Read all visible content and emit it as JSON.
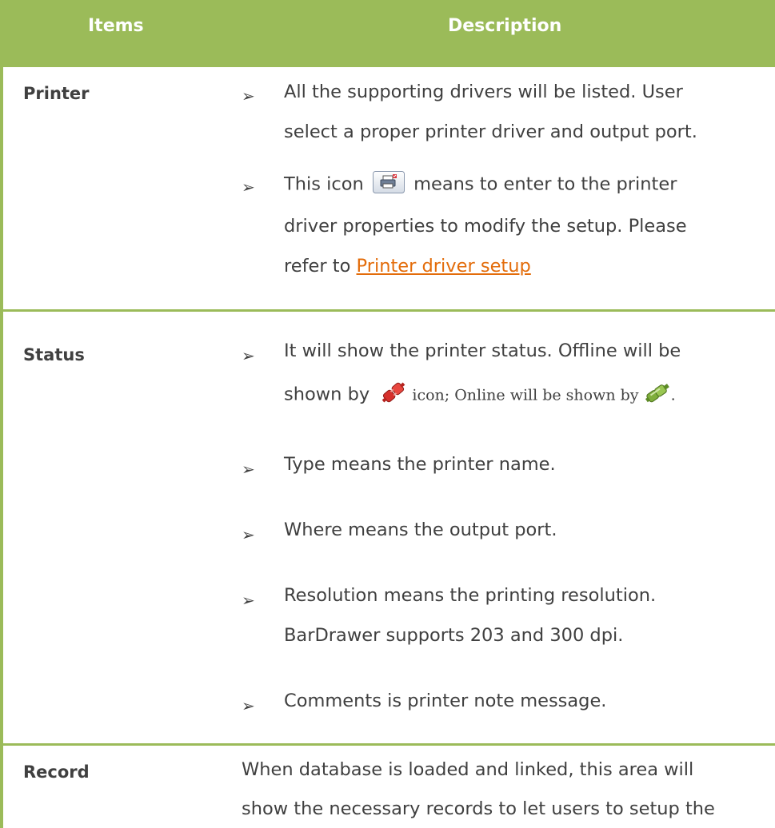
{
  "header": {
    "items_label": "Items",
    "description_label": "Description"
  },
  "rows": {
    "printer": {
      "label": "Printer",
      "bullet1_line1": "All the supporting drivers will be listed.  User",
      "bullet1_line2": "select a proper printer driver and output port.",
      "bullet2_pre": "This icon",
      "bullet2_post": "means to enter to the printer",
      "bullet2_line2": "driver properties to modify the setup. Please",
      "bullet2_line3_pre": "refer to ",
      "bullet2_link": "Printer driver setup"
    },
    "status": {
      "label": "Status",
      "bullet1_line1": "It will show the printer status. Offline will be",
      "bullet1_line2_pre": "shown by",
      "bullet1_line2_mid": " icon; Online will be shown by ",
      "bullet1_line2_end": ".",
      "bullet2": "Type means the printer name.",
      "bullet3": "Where means the output port.",
      "bullet4_line1": "Resolution means the printing resolution.",
      "bullet4_line2": "BarDrawer supports 203 and 300 dpi.",
      "bullet5": "Comments is printer note message."
    },
    "record": {
      "label": "Record",
      "line1": "When database is loaded and linked,  this area will",
      "line2": "show the necessary records to let users to setup the"
    }
  },
  "bullet_glyph": "➢",
  "icons": [
    "printer-properties-icon",
    "offline-plug-icon",
    "online-plug-icon"
  ],
  "colors": {
    "header_bg": "#9bbb59",
    "link": "#e36c0a",
    "text": "#404040"
  }
}
